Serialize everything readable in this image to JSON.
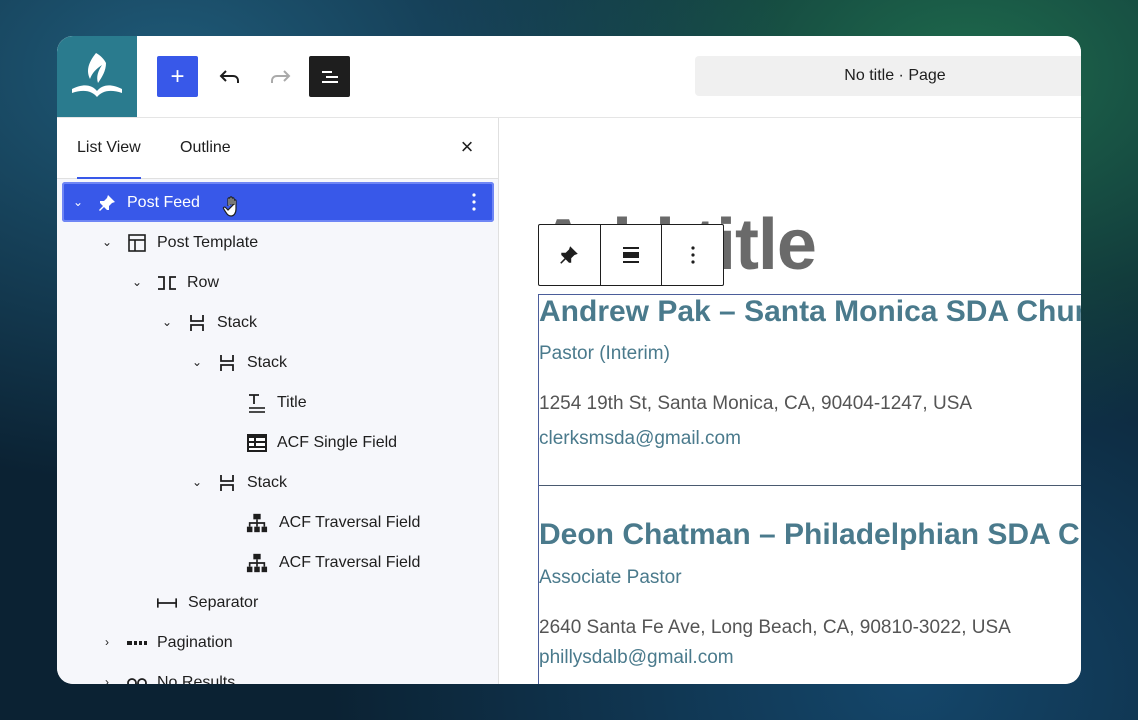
{
  "topbar": {
    "add_label": "+",
    "doc_title": "No title · Page"
  },
  "sidebar": {
    "tabs": [
      {
        "label": "List View",
        "active": true
      },
      {
        "label": "Outline",
        "active": false
      }
    ],
    "close_label": "×",
    "items": [
      {
        "label": "Post Feed",
        "icon": "pin-icon",
        "expanded": true,
        "selected": true
      },
      {
        "label": "Post Template",
        "icon": "template-icon",
        "expanded": true
      },
      {
        "label": "Row",
        "icon": "row-icon",
        "expanded": true
      },
      {
        "label": "Stack",
        "icon": "stack-icon",
        "expanded": true
      },
      {
        "label": "Stack",
        "icon": "stack-icon",
        "expanded": true
      },
      {
        "label": "Title",
        "icon": "title-icon"
      },
      {
        "label": "ACF Single Field",
        "icon": "field-icon"
      },
      {
        "label": "Stack",
        "icon": "stack-icon",
        "expanded": true
      },
      {
        "label": "ACF Traversal Field",
        "icon": "hierarchy-icon"
      },
      {
        "label": "ACF Traversal Field",
        "icon": "hierarchy-icon"
      },
      {
        "label": "Separator",
        "icon": "separator-icon"
      },
      {
        "label": "Pagination",
        "icon": "pagination-icon",
        "expanded": false
      },
      {
        "label": "No Results",
        "icon": "no-results-icon",
        "expanded": false
      }
    ]
  },
  "canvas": {
    "ghost_title": "Add title",
    "entries": [
      {
        "name": "Andrew Pak – Santa Monica SDA Church",
        "role": "Pastor (Interim)",
        "address": "1254 19th St, Santa Monica, CA, 90404-1247, USA",
        "email": "clerksmsda@gmail.com"
      },
      {
        "name": "Deon Chatman – Philadelphian SDA Church",
        "role": "Associate Pastor",
        "address": "2640 Santa Fe Ave, Long Beach, CA, 90810-3022, USA",
        "email": "phillysdalb@gmail.com"
      }
    ]
  },
  "colors": {
    "accent": "#3858e9",
    "logo_bg": "#2a7b8e",
    "entry_text": "#4a7a8c"
  }
}
